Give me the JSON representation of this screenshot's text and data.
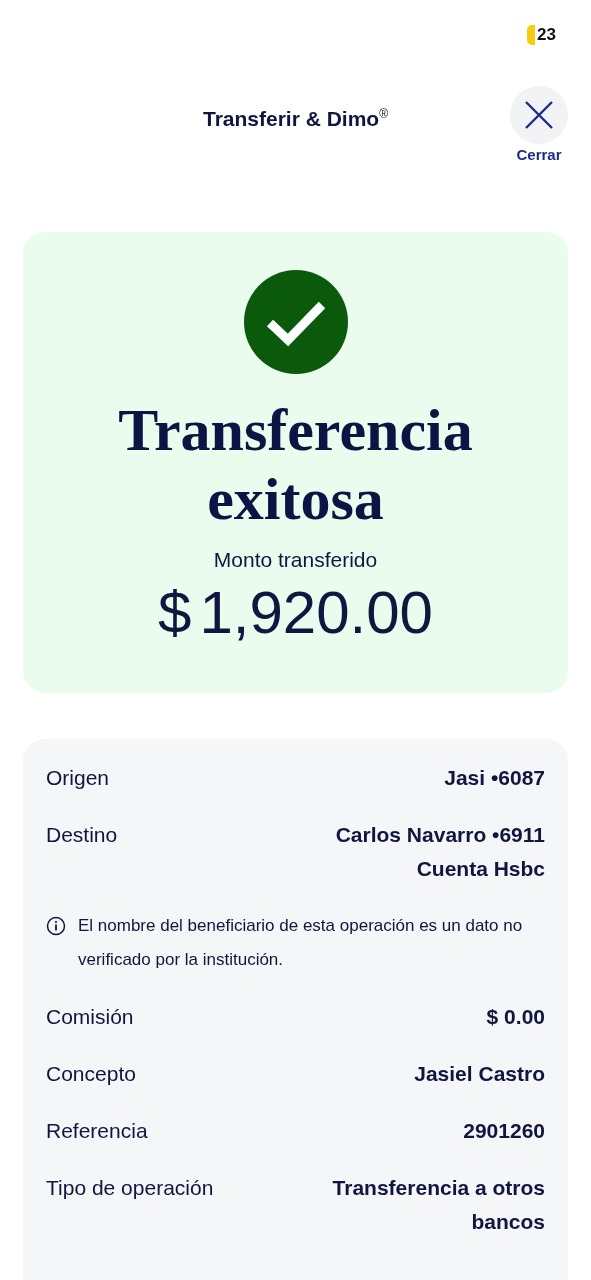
{
  "status_bar": {
    "battery": "23"
  },
  "header": {
    "title": "Transferir & Dimo",
    "title_mark": "®",
    "close_label": "Cerrar"
  },
  "success": {
    "headline": "Transferencia exitosa",
    "amount_label": "Monto transferido",
    "currency": "$",
    "amount": "1,920.00"
  },
  "details": [
    {
      "kind": "row",
      "label": "Origen",
      "values": [
        "Jasi •6087"
      ]
    },
    {
      "kind": "row",
      "label": "Destino",
      "values": [
        "Carlos Navarro •6911",
        "Cuenta Hsbc"
      ]
    },
    {
      "kind": "note",
      "text": "El nombre del beneficiario de esta operación es un dato no verificado por la institución."
    },
    {
      "kind": "row",
      "label": "Comisión",
      "values": [
        "$ 0.00"
      ]
    },
    {
      "kind": "row",
      "label": "Concepto",
      "values": [
        "Jasiel Castro"
      ]
    },
    {
      "kind": "row",
      "label": "Referencia",
      "values": [
        "2901260"
      ]
    },
    {
      "kind": "row",
      "label": "Tipo de operación",
      "values": [
        "Transferencia a otros bancos"
      ]
    }
  ]
}
